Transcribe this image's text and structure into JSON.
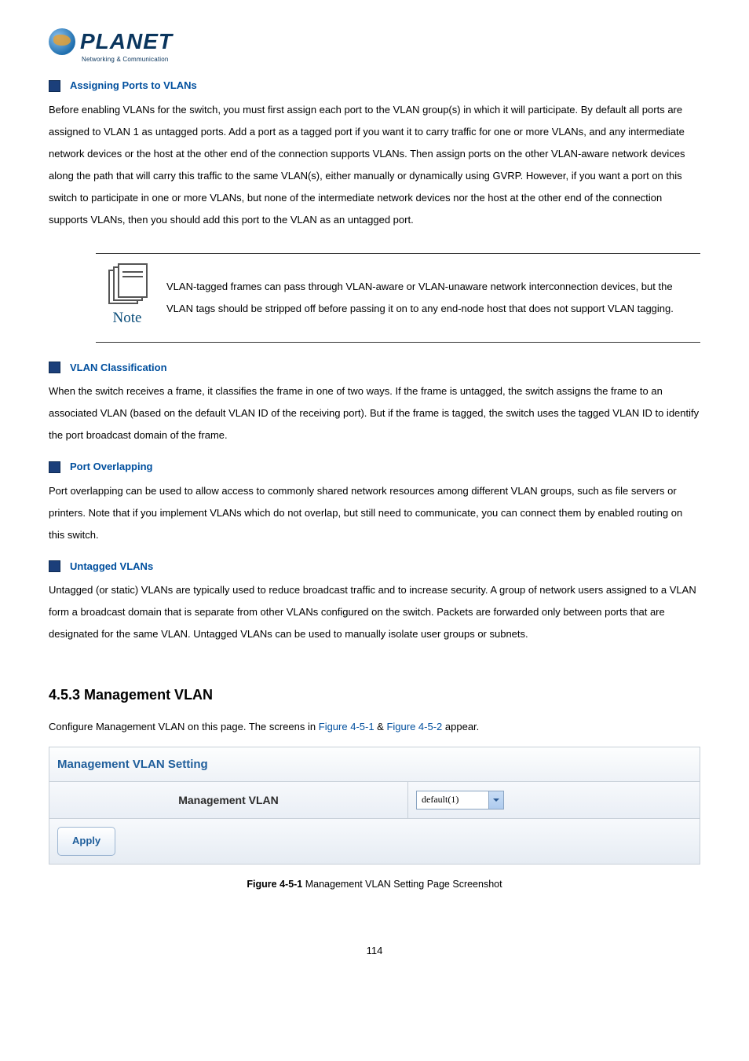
{
  "logo": {
    "brand": "PLANET",
    "tagline": "Networking & Communication"
  },
  "sections": {
    "assigning": {
      "title": "Assigning Ports to VLANs",
      "body": "Before enabling VLANs for the switch, you must first assign each port to the VLAN group(s) in which it will participate. By default all ports are assigned to VLAN 1 as untagged ports. Add a port as a tagged port if you want it to carry traffic for one or more VLANs, and any intermediate network devices or the host at the other end of the connection supports VLANs. Then assign ports on the other VLAN-aware network devices along the path that will carry this traffic to the same VLAN(s), either manually or dynamically using GVRP. However, if you want a port on this switch to participate in one or more VLANs, but none of the intermediate network devices nor the host at the other end of the connection supports VLANs, then you should add this port to the VLAN as an untagged port."
    },
    "note": {
      "label": "Note",
      "text": "VLAN-tagged frames can pass through VLAN-aware or VLAN-unaware network interconnection devices, but the VLAN tags should be stripped off before passing it on to any end-node host that does not support VLAN tagging."
    },
    "classification": {
      "title": "VLAN Classification",
      "body": "When the switch receives a frame, it classifies the frame in one of two ways. If the frame is untagged, the switch assigns the frame to an associated VLAN (based on the default VLAN ID of the receiving port). But if the frame is tagged, the switch uses the tagged VLAN ID to identify the port broadcast domain of the frame."
    },
    "overlapping": {
      "title": "Port Overlapping",
      "body": "Port overlapping can be used to allow access to commonly shared network resources among different VLAN groups, such as file servers or printers. Note that if you implement VLANs which do not overlap, but still need to communicate, you can connect them by enabled routing on this switch."
    },
    "untagged": {
      "title": "Untagged VLANs",
      "body": "Untagged (or static) VLANs are typically used to reduce broadcast traffic and to increase security. A group of network users assigned to a VLAN form a broadcast domain that is separate from other VLANs configured on the switch. Packets are forwarded only between ports that are designated for the same VLAN. Untagged VLANs can be used to manually isolate user groups or subnets."
    }
  },
  "mgmt": {
    "heading": "4.5.3 Management VLAN",
    "intro_pre": "Configure Management VLAN on this page. The screens in ",
    "fig1": "Figure 4-5-1",
    "intro_mid": " & ",
    "fig2": "Figure 4-5-2",
    "intro_post": " appear.",
    "panel_title": "Management VLAN Setting",
    "row_label": "Management VLAN",
    "dropdown_value": "default(1)",
    "apply_label": "Apply",
    "figcap_bold": "Figure 4-5-1",
    "figcap_rest": " Management VLAN Setting Page Screenshot"
  },
  "page_number": "114"
}
